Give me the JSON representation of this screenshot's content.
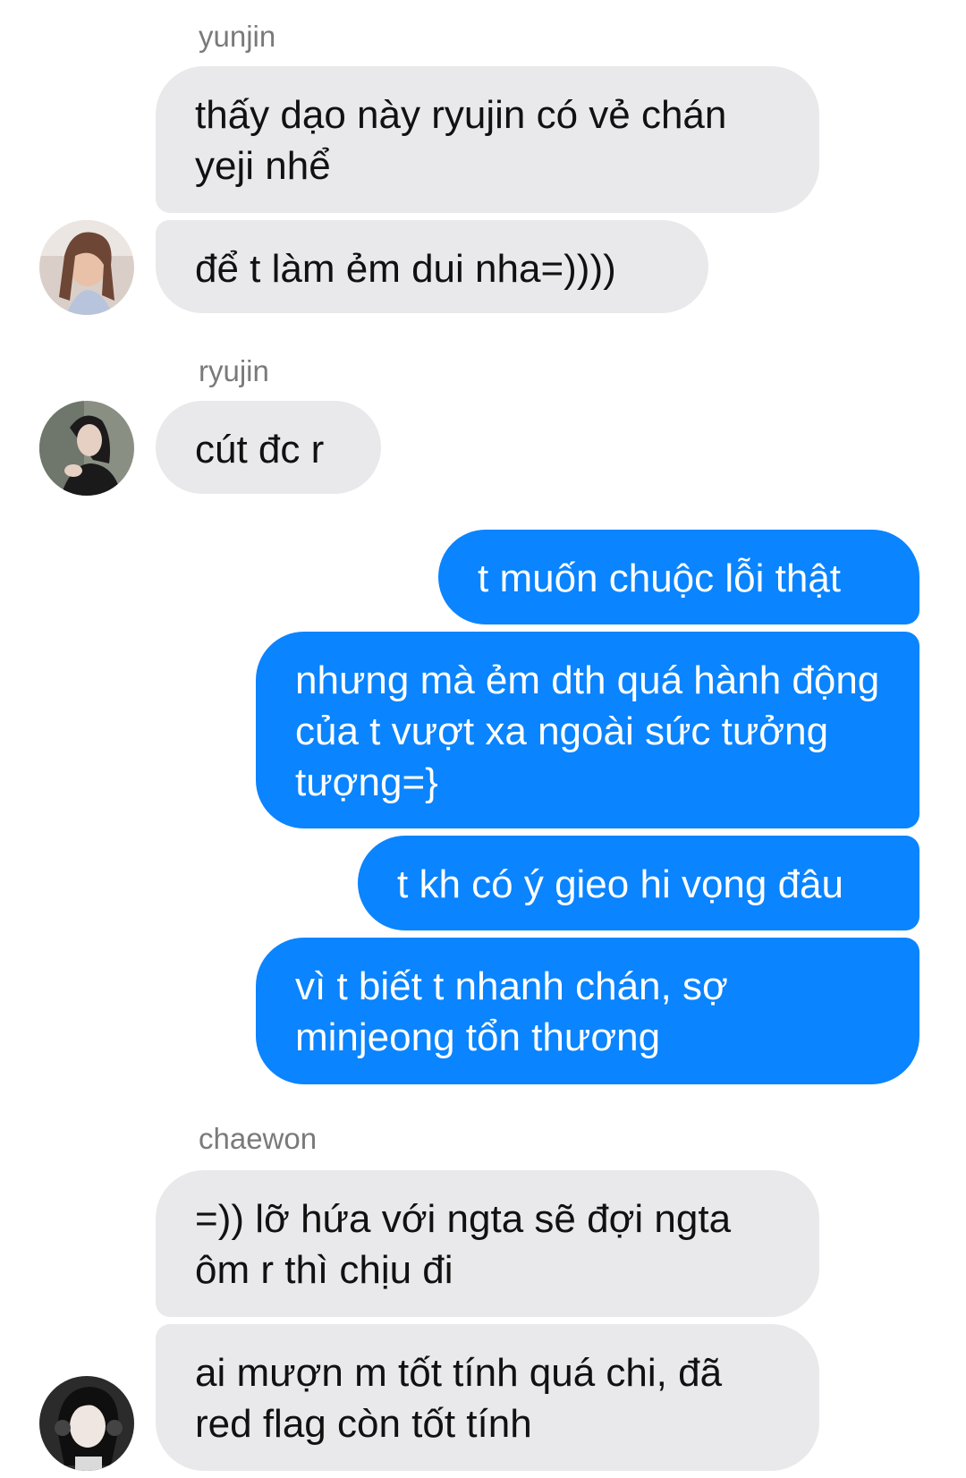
{
  "conversation": {
    "groups": [
      {
        "sender": "yunjin",
        "messages": [
          "thấy dạo này ryujin có vẻ chán yeji nhể",
          "để t làm ẻm dui nha=))))"
        ]
      },
      {
        "sender": "ryujin",
        "messages": [
          "cút đc r"
        ]
      },
      {
        "sender": "",
        "outgoing": true,
        "messages": [
          "t muốn chuộc lỗi thật",
          "nhưng mà ẻm dth quá hành động của t vượt xa ngoài sức tưởng tượng=}",
          "t kh có ý gieo hi vọng đâu",
          "vì t biết t nhanh chán, sợ minjeong tổn thương"
        ]
      },
      {
        "sender": "chaewon",
        "messages": [
          "=)) lỡ hứa với ngta sẽ đợi ngta ôm r thì chịu đi",
          "ai mượn m tốt tính quá chi, đã red flag còn tốt tính"
        ]
      }
    ]
  },
  "colors": {
    "incoming_bubble": "#e9e9eb",
    "outgoing_bubble": "#0a84ff",
    "sender_name": "#7a7a7a"
  }
}
